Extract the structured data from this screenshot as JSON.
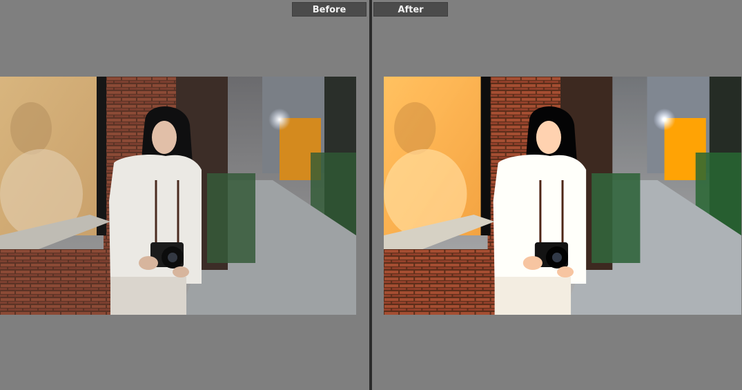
{
  "labels": {
    "before": "Before",
    "after": "After"
  },
  "colors": {
    "panel_bg": "#7f7f7f",
    "divider": "#2b2b2b",
    "tab_bg": "#4b4b4b",
    "tab_text": "#f2f2f2"
  },
  "photo": {
    "subject": "woman-with-camera",
    "scene": "brick-alley"
  }
}
